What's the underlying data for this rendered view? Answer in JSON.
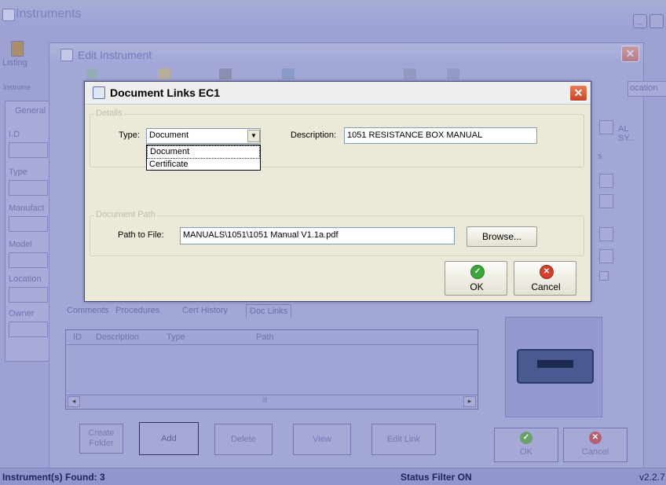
{
  "main": {
    "title": "Instruments",
    "toolbar": {
      "listing_label": "Listing"
    },
    "left_panel": {
      "header": "Instrume",
      "fields": [
        "General",
        "I.D",
        "Type",
        "Manufact",
        "Model",
        "Location",
        "Owner"
      ]
    },
    "right_panel": {
      "location_header": "ocation",
      "value_text": "AL SY...",
      "s_label": "s"
    }
  },
  "edit_window": {
    "title": "Edit Instrument",
    "tabs": [
      "Comments",
      "Procedures",
      "Cert History",
      "Doc Links"
    ],
    "active_tab": "Doc Links",
    "table_columns": [
      "ID",
      "Description",
      "Type",
      "Path"
    ],
    "scroll_thumb_label": "|||",
    "buttons": {
      "create_folder_1": "Create",
      "create_folder_2": "Folder",
      "add": "Add",
      "delete": "Delete",
      "view": "View",
      "edit_link": "Edit Link",
      "ok": "OK",
      "cancel": "Cancel"
    }
  },
  "dialog": {
    "title": "Document Links EC1",
    "details_legend": "Details",
    "type_label": "Type:",
    "type_value": "Document",
    "type_options": [
      "Document",
      "Certificate"
    ],
    "description_label": "Description:",
    "description_value": "1051 RESISTANCE BOX MANUAL",
    "path_legend": "Document Path",
    "path_label": "Path to File:",
    "path_value": "MANUALS\\1051\\1051 Manual V1.1a.pdf",
    "browse_label": "Browse...",
    "ok_label": "OK",
    "cancel_label": "Cancel"
  },
  "statusbar": {
    "found": "Instrument(s) Found: 3",
    "filter": "Status Filter ON",
    "version": "v2.2.7"
  },
  "colors": {
    "accent_green": "#3aa63a",
    "accent_red": "#d0402a",
    "overlay_blue": "#9ea2d3"
  }
}
